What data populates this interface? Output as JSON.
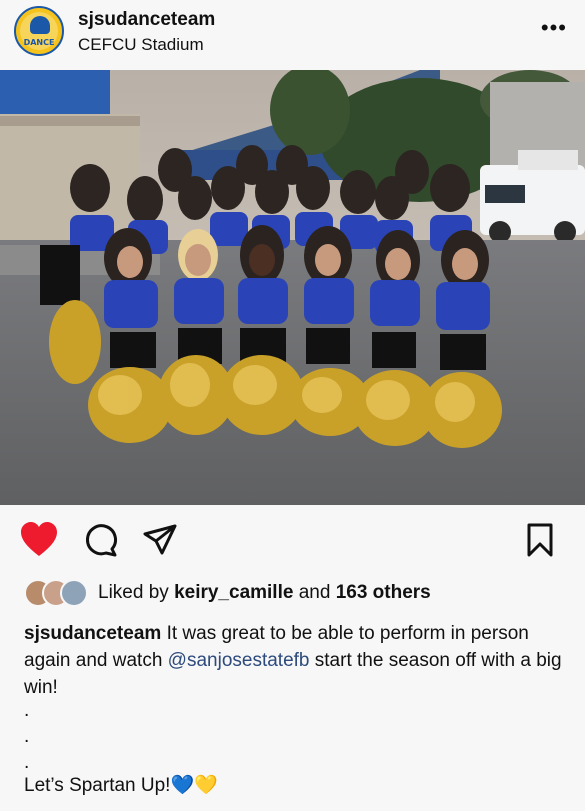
{
  "post": {
    "username": "sjsudanceteam",
    "location": "CEFCU Stadium",
    "avatar_text": "DANCE",
    "more_icon": "•••"
  },
  "actions": {
    "like_icon": "heart-icon",
    "comment_icon": "comment-icon",
    "share_icon": "share-icon",
    "save_icon": "bookmark-icon",
    "like_color": "#ee1b2e"
  },
  "likes": {
    "prefix": "Liked by",
    "user": "keiry_camille",
    "connector": "and",
    "others": "163 others"
  },
  "caption": {
    "username": "sjsudanceteam",
    "text1": "It was great to be able to perform in person again and watch",
    "mention": "@sanjosestatefb",
    "text2": "start the season off with a big win!",
    "dot": ".",
    "closing": "Let’s Spartan Up!",
    "emoji_blue": "💙",
    "emoji_yellow": "💛"
  }
}
